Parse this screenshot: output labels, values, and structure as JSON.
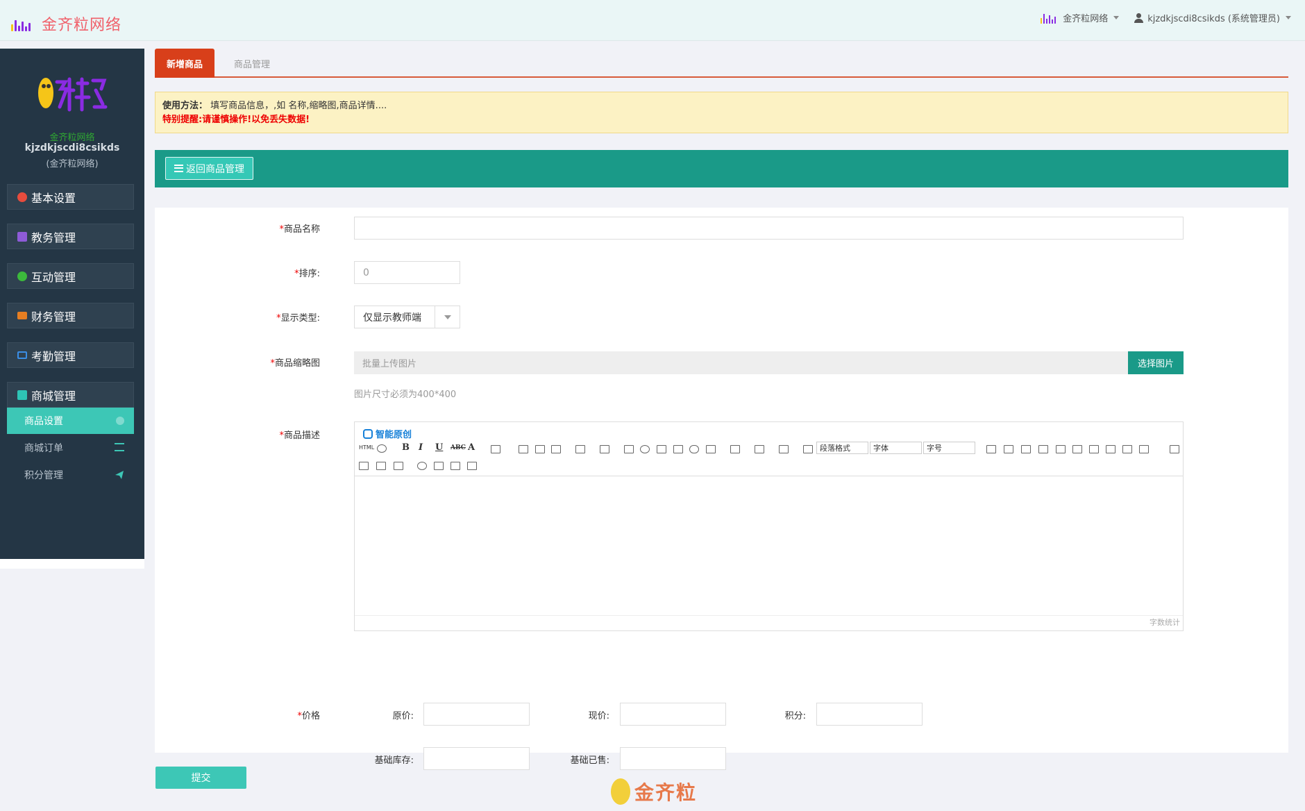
{
  "header": {
    "brand_title": "金齐粒网络",
    "org_menu": "金齐粒网络",
    "user_menu": "kjzdkjscdi8csikds (系统管理员)"
  },
  "sidebar": {
    "org_name": "金齐粒网络",
    "username": "kjzdkjscdi8csikds",
    "role": "(金齐粒网络)",
    "menus": [
      {
        "label": "基本设置",
        "icon": "gear-icon"
      },
      {
        "label": "教务管理",
        "icon": "database-icon"
      },
      {
        "label": "互动管理",
        "icon": "wechat-icon"
      },
      {
        "label": "财务管理",
        "icon": "money-icon"
      },
      {
        "label": "考勤管理",
        "icon": "card-icon"
      },
      {
        "label": "商城管理",
        "icon": "cart-icon"
      }
    ],
    "submenus": [
      {
        "label": "商品设置",
        "icon": "settings-icon"
      },
      {
        "label": "商城订单",
        "icon": "list-icon"
      },
      {
        "label": "积分管理",
        "icon": "send-icon"
      }
    ]
  },
  "tabs": {
    "new": "新增商品",
    "manage": "商品管理"
  },
  "notice": {
    "label": "使用方法：",
    "text": "填写商品信息，,如 名称,缩略图,商品详情....",
    "warning": "特别提醒:请谨慎操作!以免丢失数据!"
  },
  "actions": {
    "back": "返回商品管理",
    "submit": "提交"
  },
  "form": {
    "required_mark": "*",
    "name_label": "商品名称",
    "name_value": "",
    "sort_label": "排序:",
    "sort_value": "0",
    "type_label": "显示类型:",
    "type_value": "仅显示教师端",
    "thumb_label": "商品缩略图",
    "thumb_placeholder": "批量上传图片",
    "thumb_button": "选择图片",
    "thumb_hint": "图片尺寸必须为400*400",
    "desc_label": "商品描述",
    "price_label": "价格",
    "original_price_label": "原价:",
    "current_price_label": "现价:",
    "points_label": "积分:",
    "base_stock_label": "基础库存:",
    "base_sold_label": "基础已售:"
  },
  "editor": {
    "brand": "智能原创",
    "html_btn": "HTML",
    "bold": "B",
    "italic": "I",
    "underline": "U",
    "strike": "ABC",
    "font_color": "A",
    "paragraph": "段落格式",
    "font_family": "字体",
    "font_size": "字号",
    "word_count": "字数统计"
  },
  "footer": {
    "logo_text": "金齐粒"
  },
  "colors": {
    "accent": "#1a9a88",
    "tab_active": "#d83f1a",
    "sidebar_bg": "#243645",
    "submenu_active": "#3dc7b6"
  }
}
